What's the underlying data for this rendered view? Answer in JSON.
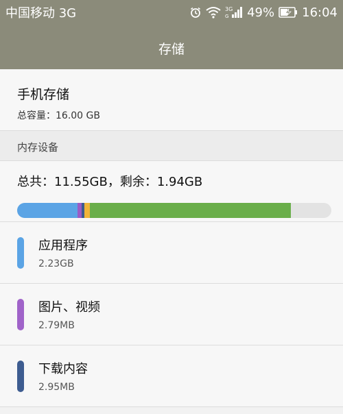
{
  "status": {
    "carrier": "中国移动 3G",
    "battery": "49%",
    "time": "16:04",
    "network_label": "3G"
  },
  "header": {
    "title": "存储"
  },
  "phone_storage": {
    "title": "手机存储",
    "total": "总容量：16.00 GB"
  },
  "internal": {
    "section_label": "内存设备",
    "summary": "总共：11.55GB，剩余：1.94GB",
    "usage_segments": [
      {
        "name": "应用程序",
        "fraction": 0.193,
        "color": "#5ba4e5"
      },
      {
        "name": "图片、视频",
        "fraction": 0.012,
        "color": "#9a5cc6"
      },
      {
        "name": "下载内容",
        "fraction": 0.008,
        "color": "#3d5c90"
      },
      {
        "name": "other-yellow",
        "fraction": 0.018,
        "color": "#f0b43a"
      },
      {
        "name": "other-green",
        "fraction": 0.64,
        "color": "#6aae4a"
      }
    ],
    "items": [
      {
        "label": "应用程序",
        "size": "2.23GB",
        "color": "#5ba4e5"
      },
      {
        "label": "图片、视频",
        "size": "2.79MB",
        "color": "#a063c9"
      },
      {
        "label": "下载内容",
        "size": "2.95MB",
        "color": "#3d5c90"
      }
    ]
  }
}
